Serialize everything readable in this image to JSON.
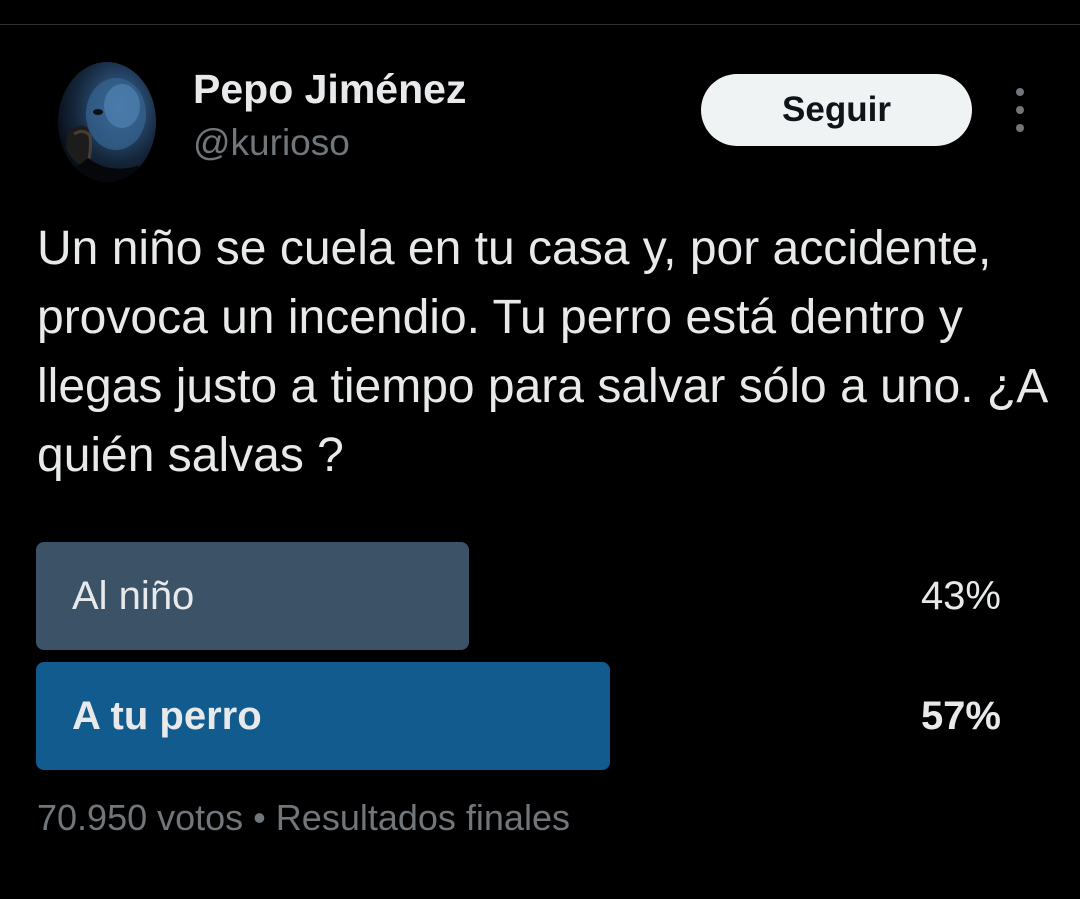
{
  "tweet": {
    "author_name": "Pepo Jiménez",
    "author_handle": "@kurioso",
    "follow_label": "Seguir",
    "text": "Un niño se cuela en tu casa y, por accidente, provoca un incendio. Tu perro está dentro y llegas justo a tiempo para salvar sólo a uno. ¿A quién salvas ?"
  },
  "poll": {
    "options": [
      {
        "label": "Al niño",
        "percent_label": "43%",
        "percent": 43,
        "winner": false
      },
      {
        "label": "A tu perro",
        "percent_label": "57%",
        "percent": 57,
        "winner": true
      }
    ],
    "votes": "70.950 votos",
    "separator": "•",
    "status": "Resultados finales"
  },
  "icons": {
    "more": "more-vertical-icon",
    "avatar": "avatar-photo"
  },
  "colors": {
    "background": "#000000",
    "text_primary": "#e7e9ea",
    "text_secondary": "#71767b",
    "follow_bg": "#eff3f4",
    "bar_winner": "#115b8f",
    "bar_loser": "#3c5266"
  }
}
